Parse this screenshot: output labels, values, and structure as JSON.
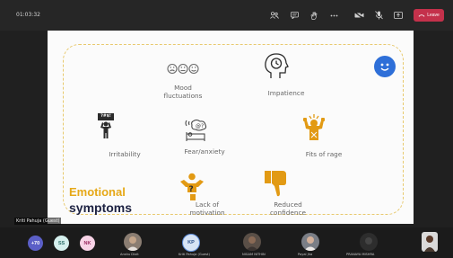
{
  "meeting": {
    "timer": "01:03:32",
    "leave_label": "Leave",
    "colors": {
      "leave": "#c4314b",
      "topbar": "#262626"
    },
    "toolbar_icons": [
      "people-icon",
      "chat-icon",
      "raise-hand-icon",
      "more-icon",
      "camera-off-icon",
      "mic-off-icon",
      "share-icon",
      "phone-icon"
    ]
  },
  "slide": {
    "title_line1": "Emotional",
    "title_line2": "symptoms",
    "symptoms": [
      {
        "label": "Mood fluctuations",
        "icon": "mood-faces-icon"
      },
      {
        "label": "Impatience",
        "icon": "clock-head-icon"
      },
      {
        "label": "Irritability",
        "icon": "angry-person-icon",
        "icon_text": "?#$!"
      },
      {
        "label": "Fear/anxiety",
        "icon": "anxious-sleeper-icon"
      },
      {
        "label": "Fits of rage",
        "icon": "rage-person-icon"
      },
      {
        "label": "Lack of motivation",
        "icon": "confused-person-icon",
        "icon_text": "?"
      },
      {
        "label": "Reduced confidence",
        "icon": "thumbs-down-icon"
      }
    ],
    "colors": {
      "accent": "#e6a817",
      "title": "#1d2242",
      "badge": "#2e6fd8"
    }
  },
  "presenter_tag": "Kriti Pahuja (Guest)",
  "participants": {
    "overflow": "+70",
    "chips": [
      {
        "initials": "SS",
        "color": "#d5f0ee"
      },
      {
        "initials": "NK",
        "color": "#f7d3e6"
      }
    ],
    "people": [
      {
        "name": "Anshu Dixit"
      },
      {
        "initials": "KP",
        "name": "Kriti Pahuja (Guest)"
      },
      {
        "name": "NIGAM NITHIN"
      },
      {
        "name": "Payal Jha"
      },
      {
        "name": "PRANAYA MISHRA"
      }
    ]
  }
}
